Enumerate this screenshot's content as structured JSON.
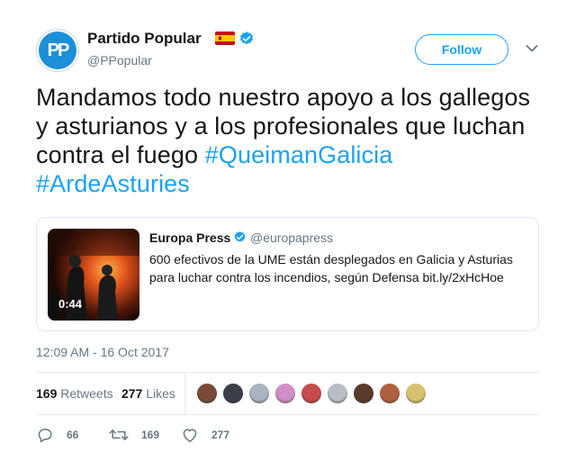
{
  "author": {
    "name": "Partido Popular",
    "handle": "@PPopular",
    "avatar_initials": "PP",
    "flag_icon": "spain-flag-icon",
    "verified_icon": "verified-badge-icon"
  },
  "follow_label": "Follow",
  "tweet": {
    "text_main": "Mandamos todo nuestro apoyo a los gallegos y asturianos y a los profesionales que luchan contra el fuego ",
    "hashtag1": "#QueimanGalicia",
    "hashtag2": "#ArdeAsturies"
  },
  "quoted": {
    "name": "Europa Press",
    "handle": "@europapress",
    "text": "600 efectivos de la UME están desplegados en Galicia y Asturias para luchar contra los incendios, según Defensa bit.ly/2xHcHoe",
    "video_duration": "0:44"
  },
  "timestamp": "12:09 AM - 16 Oct 2017",
  "stats": {
    "retweets_count": "169",
    "retweets_label": "Retweets",
    "likes_count": "277",
    "likes_label": "Likes"
  },
  "likers": [
    "#7a4a3a",
    "#3b3f4a",
    "#a8b4c0",
    "#d08ec8",
    "#c84a4a",
    "#b8bcc4",
    "#5a3a2a",
    "#b06040",
    "#d8c070"
  ],
  "actions": {
    "reply_count": "66",
    "retweet_count": "169",
    "like_count": "277"
  },
  "colors": {
    "accent": "#1da1f2",
    "secondary_text": "#657786"
  }
}
